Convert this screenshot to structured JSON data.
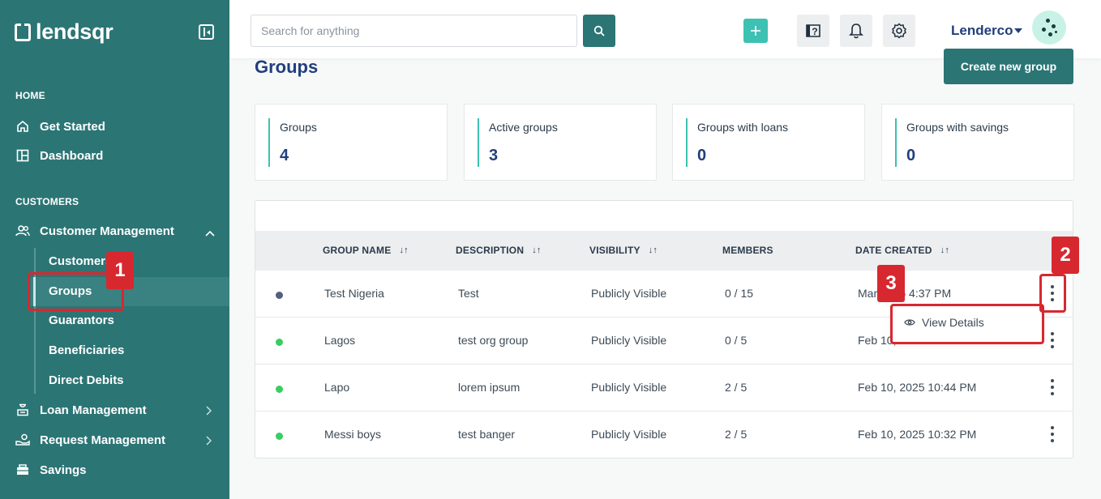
{
  "brand": {
    "name": "lendsqr"
  },
  "sidebar": {
    "sections": [
      {
        "title": "HOME"
      },
      {
        "title": "CUSTOMERS"
      }
    ],
    "home_items": [
      {
        "label": "Get Started",
        "icon": "home-icon"
      },
      {
        "label": "Dashboard",
        "icon": "dashboard-icon"
      }
    ],
    "customer_mgmt": {
      "label": "Customer Management",
      "icon": "users-icon",
      "expanded": true
    },
    "sub_items": [
      {
        "label": "Customers"
      },
      {
        "label": "Groups",
        "active": true
      },
      {
        "label": "Guarantors"
      },
      {
        "label": "Beneficiaries"
      },
      {
        "label": "Direct Debits"
      }
    ],
    "more_items": [
      {
        "label": "Loan Management",
        "icon": "loan-icon"
      },
      {
        "label": "Request Management",
        "icon": "request-icon"
      },
      {
        "label": "Savings",
        "icon": "savings-icon"
      }
    ]
  },
  "header": {
    "search_placeholder": "Search for anything",
    "user_name": "Lenderco"
  },
  "page": {
    "title": "Groups",
    "create_button": "Create new group"
  },
  "stats": [
    {
      "label": "Groups",
      "value": "4"
    },
    {
      "label": "Active groups",
      "value": "3"
    },
    {
      "label": "Groups with loans",
      "value": "0"
    },
    {
      "label": "Groups with savings",
      "value": "0"
    }
  ],
  "table": {
    "columns": [
      "GROUP NAME",
      "DESCRIPTION",
      "VISIBILITY",
      "MEMBERS",
      "DATE CREATED"
    ],
    "rows": [
      {
        "name": "Test Nigeria",
        "description": "Test",
        "visibility": "Publicly Visible",
        "members": "0 / 15",
        "date": "Mar 2025 4:37 PM",
        "status_color": "#545f7d"
      },
      {
        "name": "Lagos",
        "description": "test org group",
        "visibility": "Publicly Visible",
        "members": "0 / 5",
        "date": "Feb 10,",
        "status_color": "#39cd62"
      },
      {
        "name": "Lapo",
        "description": "lorem ipsum",
        "visibility": "Publicly Visible",
        "members": "2 / 5",
        "date": "Feb 10, 2025 10:44 PM",
        "status_color": "#39cd62"
      },
      {
        "name": "Messi boys",
        "description": "test banger",
        "visibility": "Publicly Visible",
        "members": "2 / 5",
        "date": "Feb 10, 2025 10:32 PM",
        "status_color": "#39cd62"
      }
    ]
  },
  "dropdown": {
    "view_details": "View Details"
  },
  "annotations": [
    "1",
    "2",
    "3"
  ],
  "colors": {
    "sidebar": "#2c7575",
    "accent": "#3dc1b3",
    "annotation": "#d7282f",
    "title": "#213f7d"
  }
}
